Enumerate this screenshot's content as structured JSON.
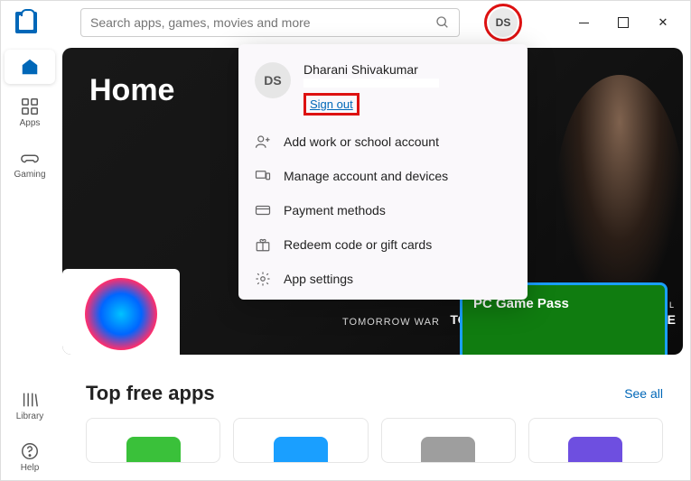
{
  "header": {
    "search_placeholder": "Search apps, games, movies and more",
    "avatar_initials": "DS"
  },
  "sidebar": {
    "items": [
      {
        "label": "Home"
      },
      {
        "label": "Apps"
      },
      {
        "label": "Gaming"
      },
      {
        "label": "Library"
      },
      {
        "label": "Help"
      }
    ]
  },
  "hero": {
    "title": "Home",
    "caption1": "TOMORROW WAR",
    "card_b_title": "PC Game Pass",
    "tag_small": "AMAZON ORIGINAL",
    "tag_big": "TOM CLANCY'S WITHOUT REMORSE"
  },
  "section": {
    "title": "Top free apps",
    "see_all": "See all"
  },
  "popup": {
    "initials": "DS",
    "name": "Dharani Shivakumar",
    "signout": "Sign out",
    "items": [
      {
        "label": "Add work or school account",
        "icon": "person-plus"
      },
      {
        "label": "Manage account and devices",
        "icon": "devices"
      },
      {
        "label": "Payment methods",
        "icon": "card"
      },
      {
        "label": "Redeem code or gift cards",
        "icon": "gift"
      },
      {
        "label": "App settings",
        "icon": "gear"
      }
    ]
  }
}
